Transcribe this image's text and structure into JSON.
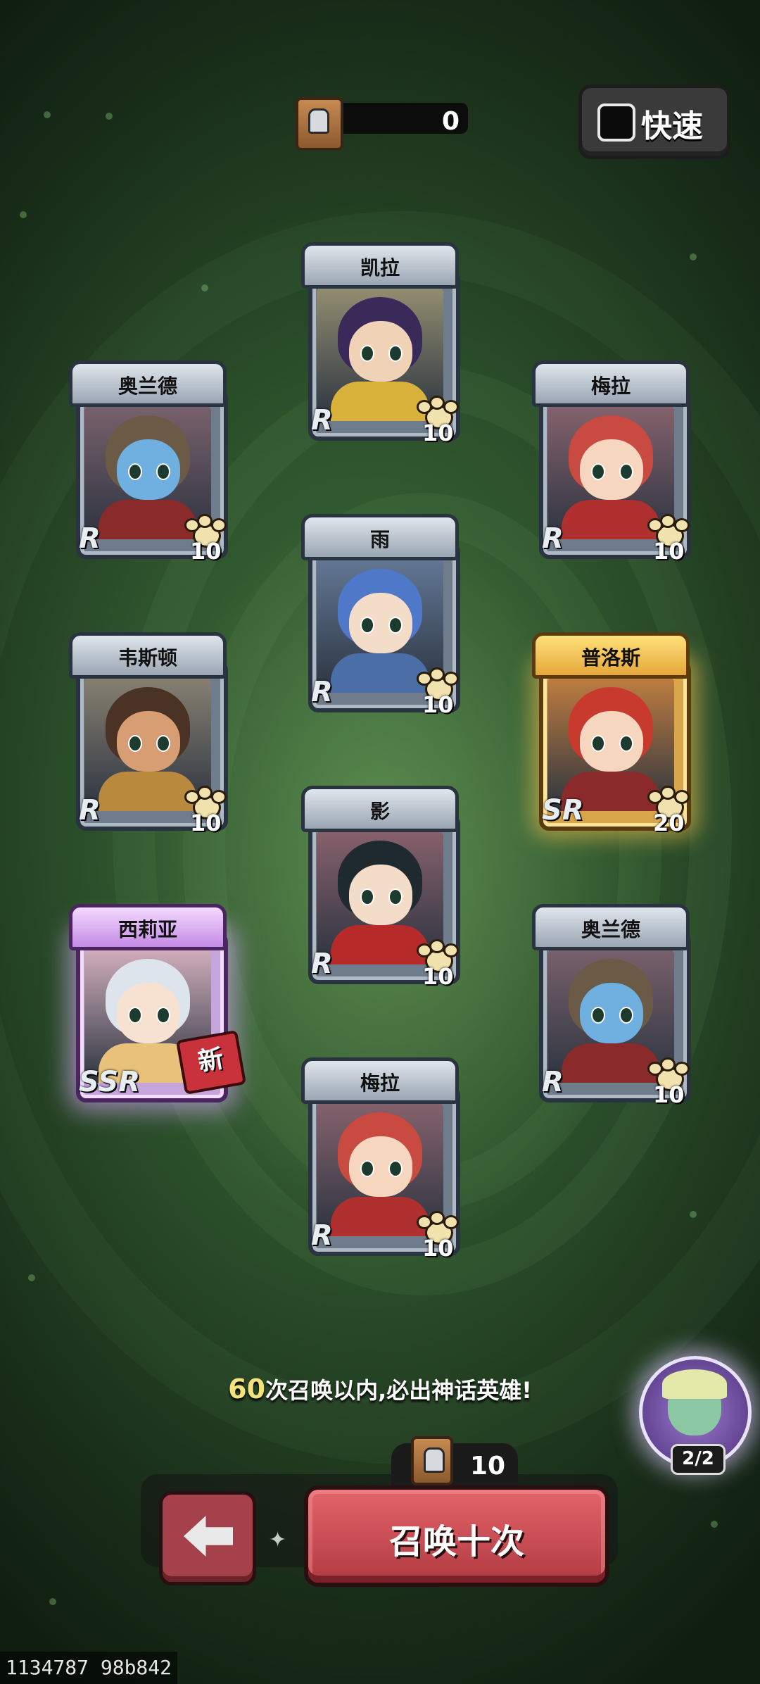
{
  "top": {
    "currency_value": "0",
    "fast_label": "快速",
    "fast_checked": false
  },
  "cards": [
    {
      "id": "kaila",
      "name": "凯拉",
      "rarity": "R",
      "count": "10",
      "tier": "r",
      "is_new": false,
      "colors": {
        "hair": "#3a2a5a",
        "skin": "#f0d2b6",
        "outfit": "#d8b23a"
      }
    },
    {
      "id": "aolande1",
      "name": "奥兰德",
      "rarity": "R",
      "count": "10",
      "tier": "r",
      "is_new": false,
      "colors": {
        "hair": "#6a5a46",
        "skin": "#6fb0e0",
        "outfit": "#8b2a2a"
      }
    },
    {
      "id": "meila1",
      "name": "梅拉",
      "rarity": "R",
      "count": "10",
      "tier": "r",
      "is_new": false,
      "colors": {
        "hair": "#c84a40",
        "skin": "#f6d6be",
        "outfit": "#b02f2f"
      }
    },
    {
      "id": "yu",
      "name": "雨",
      "rarity": "R",
      "count": "10",
      "tier": "r",
      "is_new": false,
      "colors": {
        "hair": "#4f78c8",
        "skin": "#f3dcc8",
        "outfit": "#4a6fa6"
      }
    },
    {
      "id": "weisidun",
      "name": "韦斯顿",
      "rarity": "R",
      "count": "10",
      "tier": "r",
      "is_new": false,
      "colors": {
        "hair": "#4a3224",
        "skin": "#d79e74",
        "outfit": "#b98a3e"
      }
    },
    {
      "id": "puluosi",
      "name": "普洛斯",
      "rarity": "SR",
      "count": "20",
      "tier": "sr",
      "is_new": false,
      "colors": {
        "hair": "#c83a2e",
        "skin": "#f6d6be",
        "outfit": "#8a2a2a"
      }
    },
    {
      "id": "ying",
      "name": "影",
      "rarity": "R",
      "count": "10",
      "tier": "r",
      "is_new": false,
      "colors": {
        "hair": "#1e2a2e",
        "skin": "#f3dcc8",
        "outfit": "#b72a2a"
      }
    },
    {
      "id": "xiliya",
      "name": "西莉亚",
      "rarity": "SSR",
      "count": "",
      "tier": "ssr",
      "is_new": true,
      "new_label": "新",
      "colors": {
        "hair": "#dde4ec",
        "skin": "#f7e2d2",
        "outfit": "#e8c27a"
      }
    },
    {
      "id": "aolande2",
      "name": "奥兰德",
      "rarity": "R",
      "count": "10",
      "tier": "r",
      "is_new": false,
      "colors": {
        "hair": "#6a5a46",
        "skin": "#6fb0e0",
        "outfit": "#8b2a2a"
      }
    },
    {
      "id": "meila2",
      "name": "梅拉",
      "rarity": "R",
      "count": "10",
      "tier": "r",
      "is_new": false,
      "colors": {
        "hair": "#c84a40",
        "skin": "#f6d6be",
        "outfit": "#b02f2f"
      }
    }
  ],
  "hint": {
    "number": "60",
    "text": "次召唤以内,必出神话英雄!"
  },
  "summon": {
    "cost": "10",
    "label": "召唤十次"
  },
  "pity_badge": {
    "fraction": "2/2"
  },
  "footer": {
    "build": "1134787 98b842"
  }
}
